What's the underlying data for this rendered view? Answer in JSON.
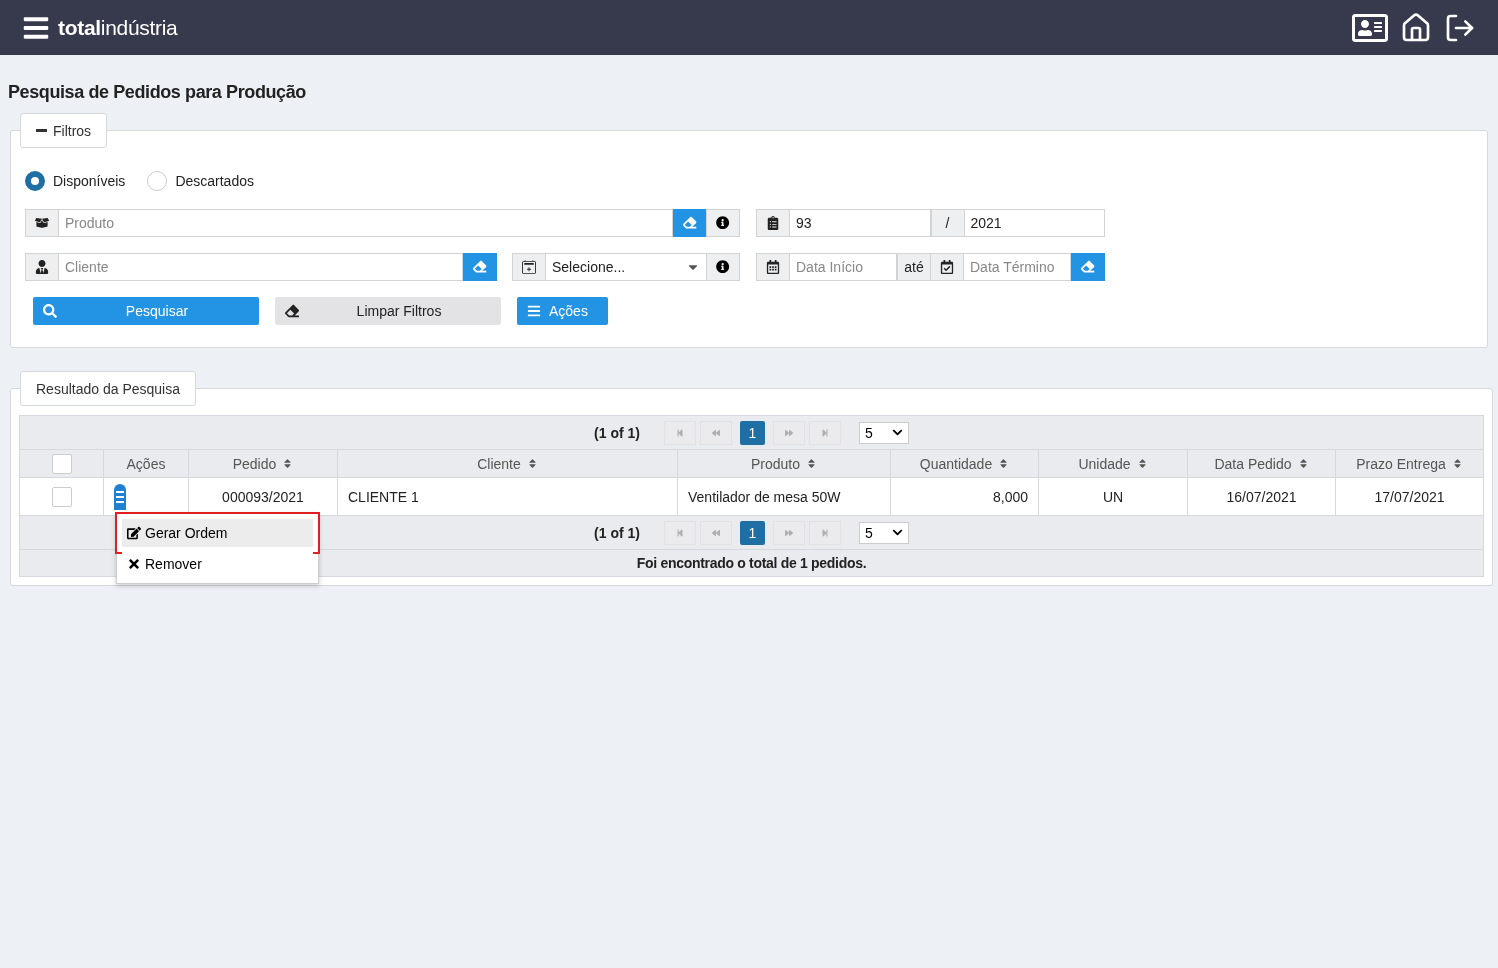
{
  "header": {
    "logo": "**total**indústria"
  },
  "page_title": "Pesquisa de Pedidos para Produção",
  "filters": {
    "legend": "Filtros",
    "expanded": true,
    "status_options": [
      {
        "label": "Disponíveis",
        "selected": true
      },
      {
        "label": "Descartados",
        "selected": false
      }
    ],
    "product": {
      "placeholder": "Produto"
    },
    "order": {
      "number": "93",
      "separator": "/",
      "year": "2021"
    },
    "client": {
      "placeholder": "Cliente"
    },
    "type_select": {
      "value": "Selecione..."
    },
    "dates": {
      "start_placeholder": "Data Início",
      "between": "até",
      "end_placeholder": "Data Término"
    },
    "buttons": [
      {
        "label": "Pesquisar",
        "kind": "search"
      },
      {
        "label": "Limpar Filtros",
        "kind": "clear"
      },
      {
        "label": "Ações",
        "kind": "actions"
      }
    ]
  },
  "results": {
    "legend": "Resultado da Pesquisa",
    "paginators": [
      {
        "summary": "(1 of 1)",
        "nav_disabled": true,
        "pages": [
          {
            "label": "1",
            "selected": true
          }
        ],
        "rows_per_page": "5"
      },
      {
        "summary": "(1 of 1)",
        "nav_disabled": true,
        "pages": [
          {
            "label": "1",
            "selected": true
          }
        ],
        "rows_per_page": "5"
      }
    ],
    "header_checked": false,
    "columns": [
      {
        "label": "Ações",
        "sortable": false
      },
      {
        "label": "Pedido",
        "sortable": true
      },
      {
        "label": "Cliente",
        "sortable": true
      },
      {
        "label": "Produto",
        "sortable": true
      },
      {
        "label": "Quantidade",
        "sortable": true
      },
      {
        "label": "Unidade",
        "sortable": true
      },
      {
        "label": "Data Pedido",
        "sortable": true
      },
      {
        "label": "Prazo Entrega",
        "sortable": true
      }
    ],
    "rows": [
      {
        "checked": false,
        "cells": [
          "",
          "000093/2021",
          "CLIENTE 1",
          "Ventilador de mesa 50W",
          "8,000",
          "UN",
          "16/07/2021",
          "17/07/2021"
        ]
      }
    ],
    "action_menu": [
      {
        "label": "Gerar Ordem",
        "kind": "edit",
        "selected": true,
        "framed": true
      },
      {
        "label": "Remover",
        "kind": "remove",
        "selected": false,
        "framed": false
      }
    ],
    "footer": "Foi encontrado o total de 1 pedidos."
  }
}
